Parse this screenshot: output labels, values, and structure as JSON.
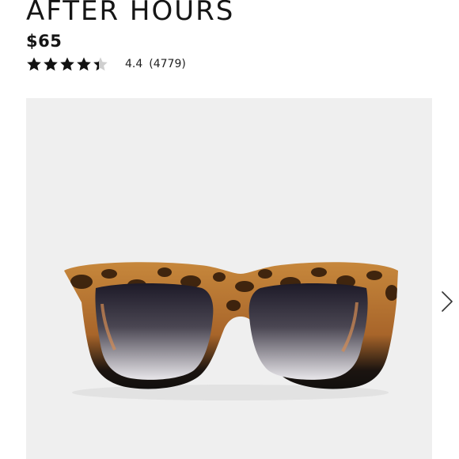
{
  "product": {
    "title": "AFTER HOURS",
    "price": "$65",
    "rating": {
      "value": "4.4",
      "count": "(4779)",
      "stars_filled": 4.4,
      "stars_total": 5
    },
    "image": {
      "subject": "sunglasses-icon"
    }
  },
  "carousel": {
    "next_icon": "chevron-right-icon"
  },
  "colors": {
    "text": "#151515",
    "star": "#111111",
    "star_empty": "#cfcfcf",
    "image_bg": "#efefef",
    "frame_black": "#0d0d0d",
    "tortoise_light": "#c98a3d",
    "tortoise_dark": "#2a1608"
  }
}
